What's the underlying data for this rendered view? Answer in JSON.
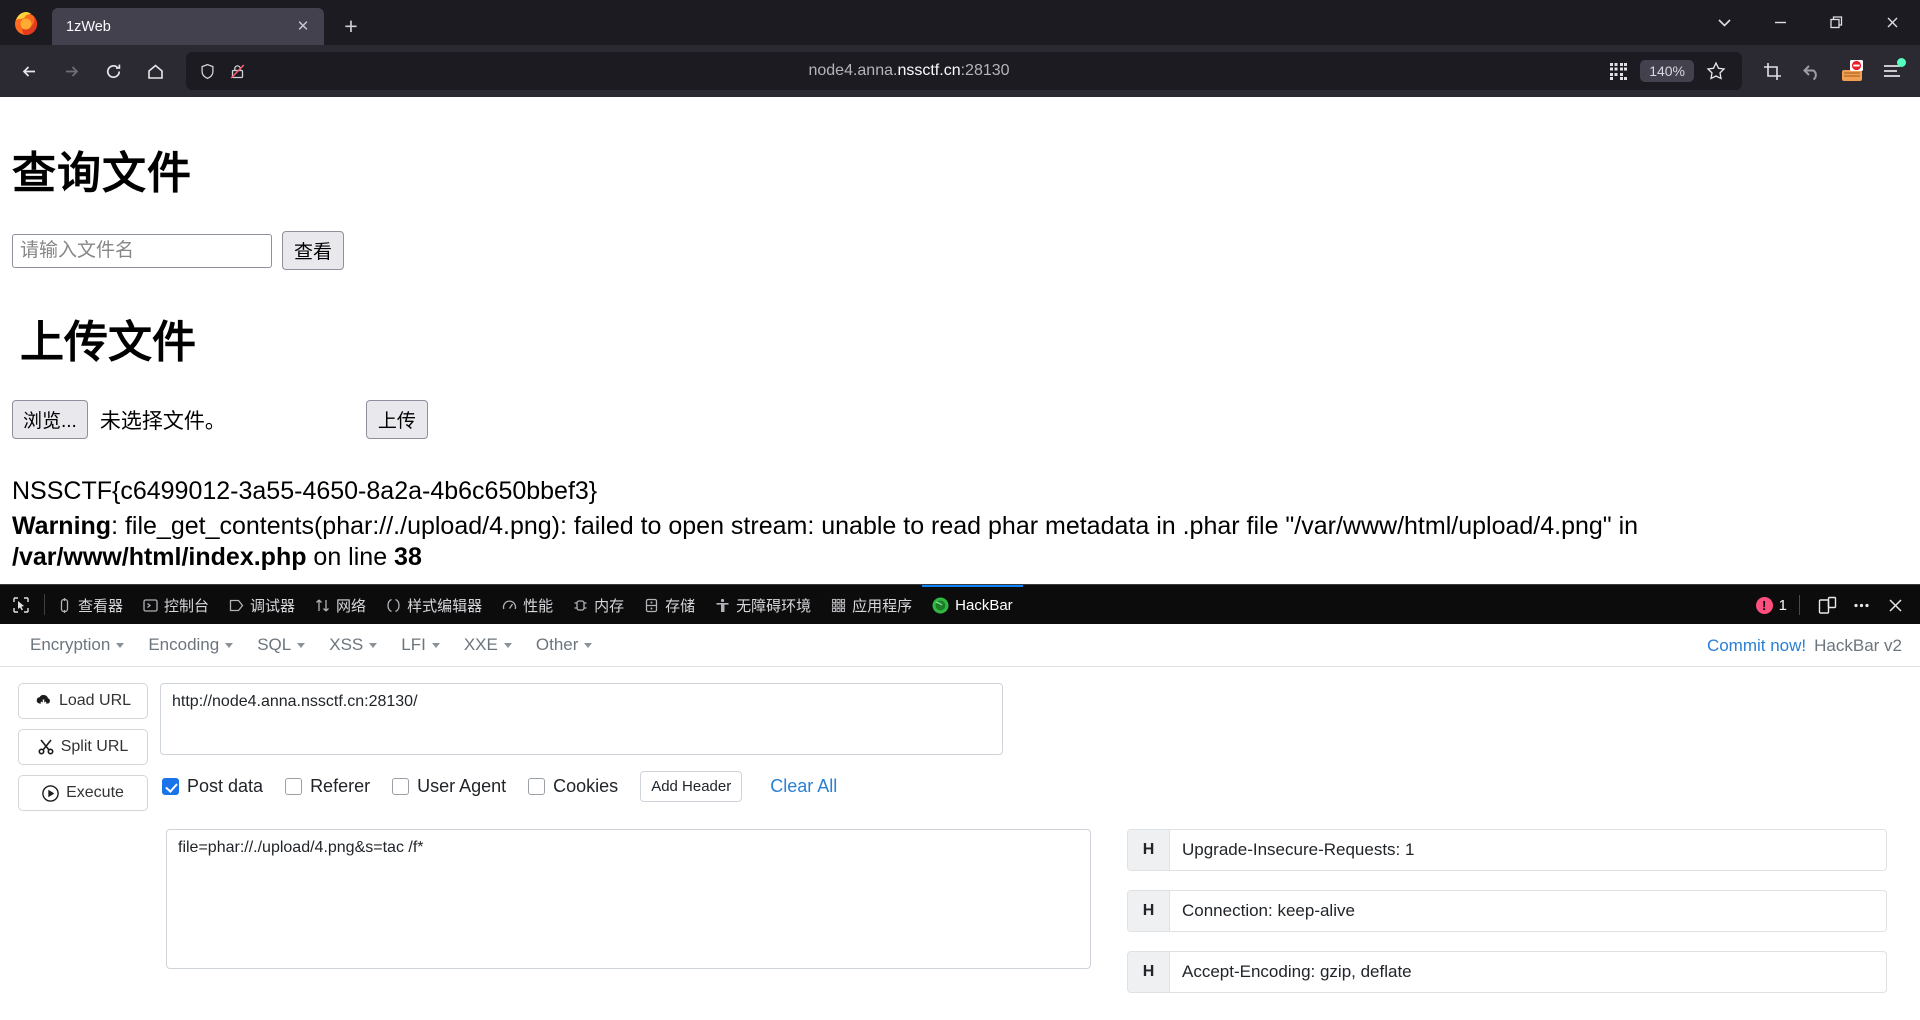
{
  "browser": {
    "tab": {
      "title": "1zWeb",
      "close_label": "✕"
    },
    "newtab_label": "+",
    "window_controls": {
      "list_all_tabs": "list-tabs",
      "minimize": "—",
      "restore": "restore",
      "close": "✕"
    },
    "nav": {
      "back": "back",
      "forward": "forward",
      "reload": "reload",
      "home": "home"
    },
    "url": {
      "prefix": "node4.anna.",
      "host": "nssctf.cn",
      "port": ":28130",
      "full": "node4.anna.nssctf.cn:28130"
    },
    "zoom_level": "140%",
    "icons": {
      "shield": "shield-icon",
      "lock_broken": "broken-lock-icon",
      "qr": "qr-code-icon",
      "bookmark": "star-icon",
      "screenshot": "crop-screenshot-icon",
      "undo": "undo-arrow-icon",
      "extension": "hackbar-extension-icon",
      "menu": "app-menu-icon"
    }
  },
  "page": {
    "query_heading": "查询文件",
    "query_placeholder": "请输入文件名",
    "query_value": "",
    "query_button": "查看",
    "upload_heading": "上传文件",
    "file_browse_button": "浏览...",
    "file_status": "未选择文件。",
    "upload_button": "上传",
    "flag": "NSSCTF{c6499012-3a55-4650-8a2a-4b6c650bbef3}",
    "warning_label": "Warning",
    "warning_text_1": ": file_get_contents(phar://./upload/4.png): failed to open stream: unable to read phar metadata in .phar file \"/var/www/html/upload/4.png\" in ",
    "warning_path": "/var/www/html/index.php",
    "warning_text_2": " on line ",
    "warning_line": "38"
  },
  "devtools": {
    "picker_icon": "element-picker-icon",
    "tabs": [
      {
        "label": "查看器",
        "icon": "inspector-icon",
        "active": false
      },
      {
        "label": "控制台",
        "icon": "console-icon",
        "active": false
      },
      {
        "label": "调试器",
        "icon": "debugger-icon",
        "active": false
      },
      {
        "label": "网络",
        "icon": "network-icon",
        "active": false
      },
      {
        "label": "样式编辑器",
        "icon": "style-editor-icon",
        "active": false
      },
      {
        "label": "性能",
        "icon": "performance-icon",
        "active": false
      },
      {
        "label": "内存",
        "icon": "memory-icon",
        "active": false
      },
      {
        "label": "存储",
        "icon": "storage-icon",
        "active": false
      },
      {
        "label": "无障碍环境",
        "icon": "accessibility-icon",
        "active": false
      },
      {
        "label": "应用程序",
        "icon": "application-icon",
        "active": false
      },
      {
        "label": "HackBar",
        "icon": "hackbar-icon",
        "active": true
      }
    ],
    "error_count": "1",
    "error_color": "#ff4f7e",
    "responsive_icon": "responsive-design-mode-icon",
    "more_icon": "more-options-icon",
    "close_icon": "close-devtools-icon",
    "active_tab_accent": "#0a84ff"
  },
  "hackbar": {
    "menus": [
      {
        "label": "Encryption"
      },
      {
        "label": "Encoding"
      },
      {
        "label": "SQL"
      },
      {
        "label": "XSS"
      },
      {
        "label": "LFI"
      },
      {
        "label": "XXE"
      },
      {
        "label": "Other"
      }
    ],
    "commit_link": "Commit now!",
    "version": "HackBar v2",
    "link_color": "#2a7fd4",
    "actions": [
      {
        "label": "Load URL",
        "icon": "cloud-download-icon"
      },
      {
        "label": "Split URL",
        "icon": "scissors-icon"
      },
      {
        "label": "Execute",
        "icon": "play-circle-icon"
      }
    ],
    "url_value": "http://node4.anna.nssctf.cn:28130/",
    "options": [
      {
        "label": "Post data",
        "checked": true
      },
      {
        "label": "Referer",
        "checked": false
      },
      {
        "label": "User Agent",
        "checked": false
      },
      {
        "label": "Cookies",
        "checked": false
      }
    ],
    "add_header_label": "Add Header",
    "clear_all_label": "Clear All",
    "post_data_value": "file=phar://./upload/4.png&s=tac /f*",
    "header_prefix": "H",
    "headers": [
      {
        "value": "Upgrade-Insecure-Requests: 1"
      },
      {
        "value": "Connection: keep-alive"
      },
      {
        "value": "Accept-Encoding: gzip, deflate"
      }
    ]
  }
}
